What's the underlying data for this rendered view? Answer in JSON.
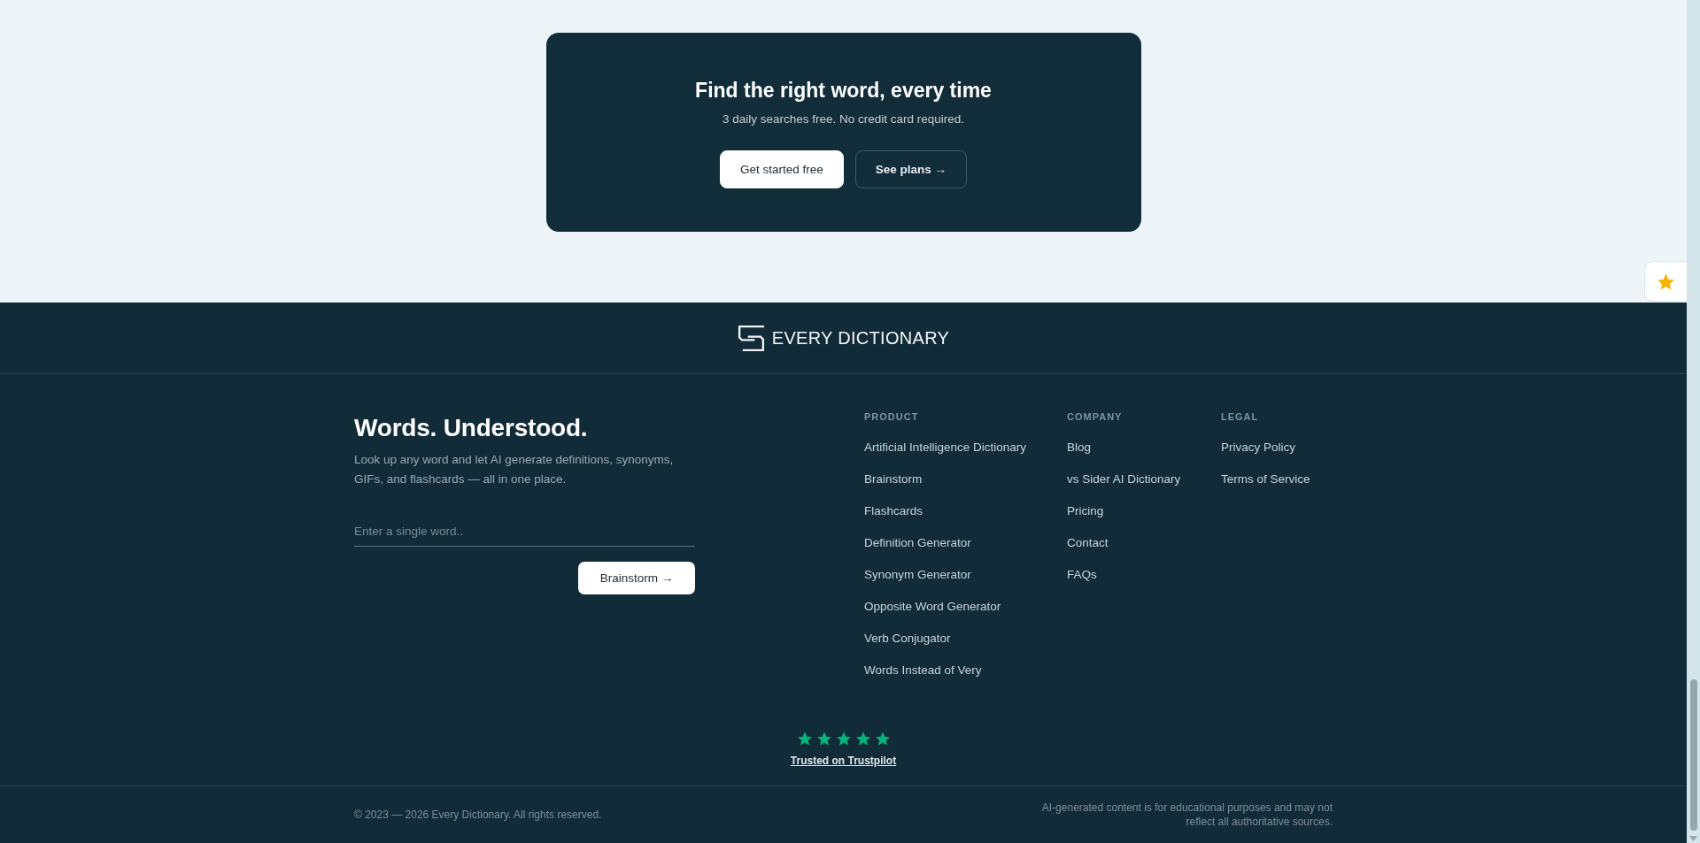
{
  "cta": {
    "title": "Find the right word, every time",
    "subtitle": "3 daily searches free. No credit card required.",
    "buttons": [
      {
        "label": "Get started free",
        "kind": "primary"
      },
      {
        "label": "See plans →",
        "kind": "outline"
      }
    ]
  },
  "footer": {
    "logo": "EVERY DICTIONARY",
    "tagline": "Words. Understood.",
    "description": "Look up any word and let AI generate definitions, synonyms, GIFs, and flashcards — all in one place.",
    "search": {
      "placeholder": "Enter a single word.."
    },
    "search_button": "Brainstorm →",
    "columns": [
      {
        "heading": "PRODUCT",
        "links": [
          "Artificial Intelligence Dictionary",
          "Brainstorm",
          "Flashcards",
          "Definition Generator",
          "Synonym Generator",
          "Opposite Word Generator",
          "Verb Conjugator",
          "Words Instead of Very"
        ]
      },
      {
        "heading": "COMPANY",
        "links": [
          "Blog",
          "vs Sider AI Dictionary",
          "Pricing",
          "Contact",
          "FAQs"
        ]
      },
      {
        "heading": "LEGAL",
        "links": [
          "Privacy Policy",
          "Terms of Service"
        ]
      }
    ],
    "rating": {
      "stars": 5,
      "link": "Trusted on Trustpilot"
    },
    "copyright": "© 2023 — 2026 Every Dictionary. All rights reserved.",
    "disclaimer": "AI-generated content is for educational purposes and may not reflect all authoritative sources."
  }
}
